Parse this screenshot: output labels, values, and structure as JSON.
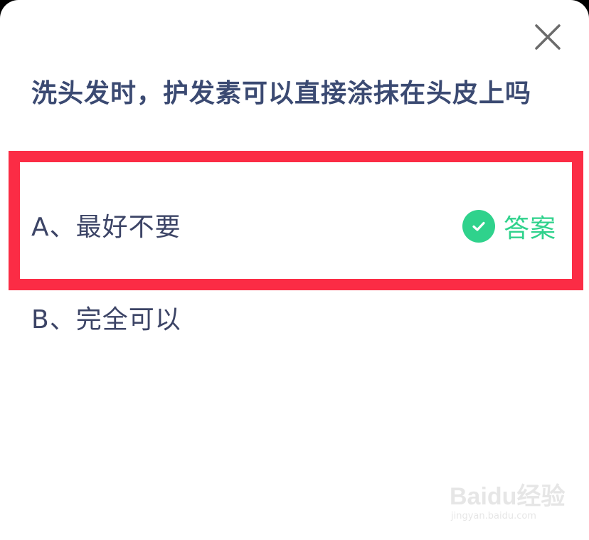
{
  "question": {
    "text": "洗头发时，护发素可以直接涂抹在头皮上吗"
  },
  "options": [
    {
      "letter": "A",
      "label": "A、最好不要",
      "is_answer": true,
      "tag": "答案",
      "highlighted": true
    },
    {
      "letter": "B",
      "label": "B、完全可以",
      "is_answer": false
    }
  ],
  "close": {
    "icon": "close-icon"
  },
  "colors": {
    "question_text": "#3b4a72",
    "option_text": "#3c4466",
    "answer_green": "#2fd28c",
    "highlight_red": "#fb2c45",
    "background": "#ffffff"
  },
  "watermark": {
    "logo": "Baidu经验",
    "url": "jingyan.baidu.com"
  }
}
